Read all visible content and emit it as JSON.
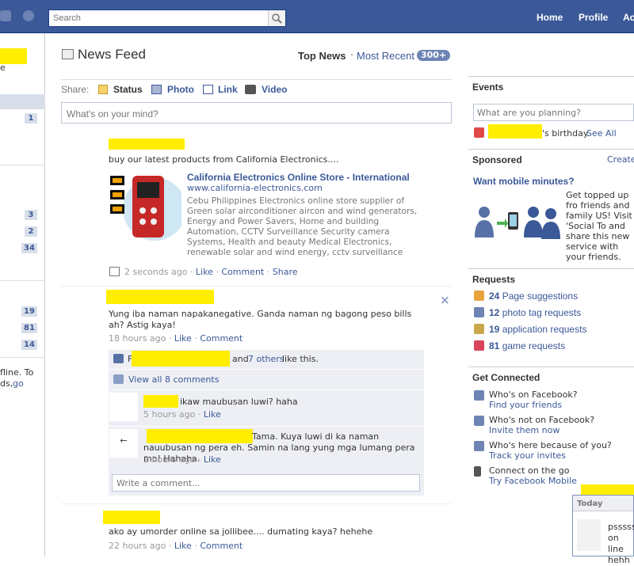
{
  "header": {
    "search_placeholder": "Search",
    "nav": [
      "Home",
      "Profile",
      "Ac"
    ]
  },
  "left": {
    "snippet_e": "e",
    "counts": [
      "1",
      "3",
      "2",
      "34",
      "19",
      "81",
      "14"
    ],
    "offline_line1": "fline. To",
    "offline_line2": "ds,",
    "offline_go": "go"
  },
  "feed": {
    "title": "News Feed",
    "top_news": "Top News",
    "dot": "·",
    "most_recent": "Most Recent",
    "badge": "300+",
    "share_label": "Share:",
    "share_items": [
      "Status",
      "Photo",
      "Link",
      "Video"
    ],
    "status_placeholder": "What's on your mind?"
  },
  "posts": [
    {
      "text": "buy our latest products from California Electronics....",
      "link_title": "California Electronics Online Store - International",
      "link_url": "www.california-electronics.com",
      "link_desc": "Cebu Philippines Electronics online store supplier of Green solar airconditioner aircon and wind generators, Energy and Power Savers, Home and building Automation, CCTV Surveillance Security camera Systems, Health and beauty Medical Electronics, renewable solar and wind energy, cctv surveillance",
      "time": "2 seconds ago",
      "actions": [
        "Like",
        "Comment",
        "Share"
      ]
    },
    {
      "text": "Yung iba naman napakanegative. Ganda naman ng bagong peso bills ah? Astig kaya!",
      "time": "18 hours ago",
      "actions": [
        "Like",
        "Comment"
      ],
      "close": "×",
      "likes_prefix": "F",
      "likes_and": "and",
      "likes_others": "7 others",
      "likes_suffix": "like this.",
      "view_all": "View all 8 comments",
      "comments": [
        {
          "text": "ikaw maubusan luwi? haha",
          "time": "5 hours ago",
          "like": "Like"
        },
        {
          "text": "Tama. Kuya luwi di ka naman nauubusan ng pera eh. Samin na lang yung mga lumang pera mo! Hahaha.",
          "time": "2 hours ago",
          "like": "Like"
        }
      ],
      "write_comment": "Write a comment..."
    },
    {
      "text": "ako ay umorder online sa jollibee.... dumating kaya? hehehe",
      "time": "22 hours ago",
      "actions": [
        "Like",
        "Comment"
      ]
    }
  ],
  "right": {
    "events_title": "Events",
    "events_placeholder": "What are you planning?",
    "birthday_text": "'s birthday.",
    "see_all": "See All",
    "sponsored_title": "Sponsored",
    "create": "Create",
    "ad_title": "Want mobile minutes?",
    "ad_text": "Get topped up fro friends and family US! Visit 'Social To and share this new service with your friends.",
    "requests_title": "Requests",
    "requests": [
      {
        "count": "24",
        "label": "Page suggestions"
      },
      {
        "count": "12",
        "label": "photo tag requests"
      },
      {
        "count": "19",
        "label": "application requests"
      },
      {
        "count": "81",
        "label": "game requests"
      }
    ],
    "connected_title": "Get Connected",
    "connected": [
      {
        "q": "Who's on Facebook?",
        "link": "Find your friends"
      },
      {
        "q": "Who's not on Facebook?",
        "link": "Invite them now"
      },
      {
        "q": "Who's here because of you?",
        "link": "Track your invites"
      },
      {
        "q": "Connect on the go",
        "link": "Try Facebook Mobile"
      }
    ]
  },
  "chat": {
    "today": "Today",
    "lines": [
      "psssss",
      "on line",
      "hehh"
    ]
  },
  "colors": {
    "brand": "#3b5998",
    "highlight": "#ffee00",
    "comment_bg": "#edeff4"
  }
}
